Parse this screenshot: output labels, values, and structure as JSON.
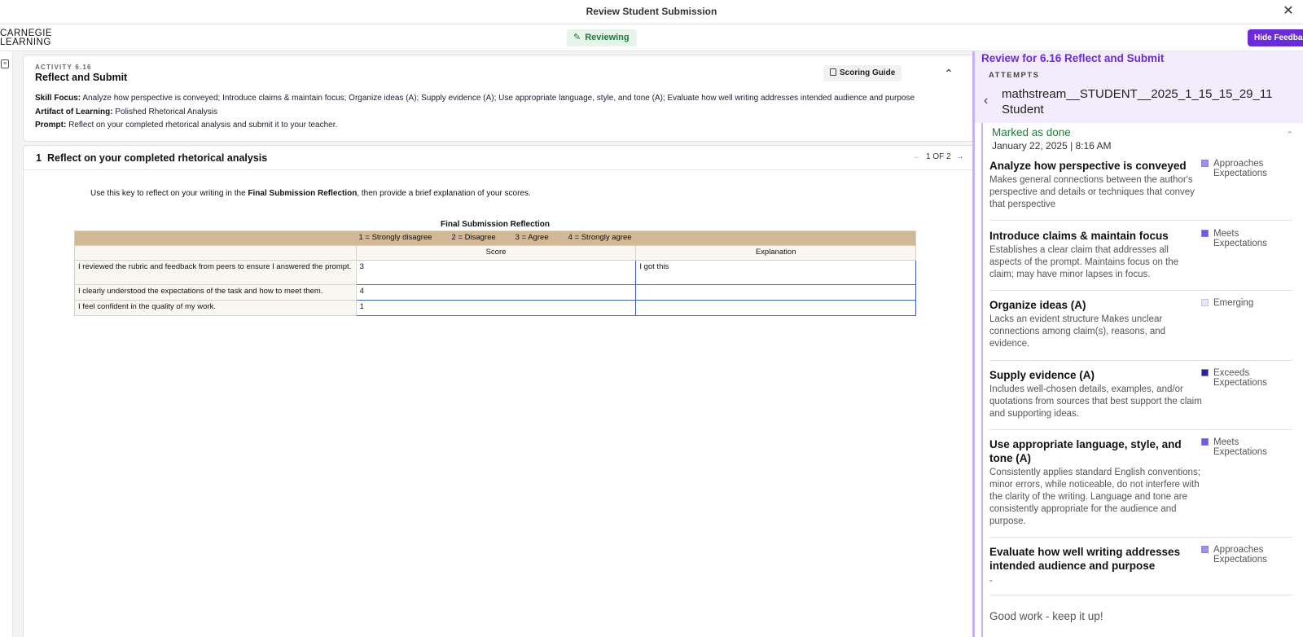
{
  "window": {
    "title": "Review Student Submission",
    "close": "✕"
  },
  "toolbar": {
    "logo_line1": "CARNEGIE",
    "logo_line2": "LEARNING",
    "status_label": "Reviewing",
    "hide_feedback_label": "Hide Feedback"
  },
  "activity": {
    "label": "ACTIVITY 6.16",
    "title": "Reflect and Submit",
    "scoring_guide_label": "Scoring Guide",
    "skill_focus_label": "Skill Focus:",
    "skill_focus": "Analyze how perspective is conveyed; Introduce claims & maintain focus; Organize ideas (A); Supply evidence (A); Use appropriate language, style, and tone (A); Evaluate how well writing addresses intended audience and purpose",
    "artifact_label": "Artifact of Learning:",
    "artifact": "Polished Rhetorical Analysis",
    "prompt_label": "Prompt:",
    "prompt": "Reflect on your completed rhetorical analysis and submit it to your teacher."
  },
  "question": {
    "number": "1",
    "title": "Reflect on your completed rhetorical analysis",
    "pager": "1 OF 2",
    "instruction_pre": "Use this key to reflect on your writing in the ",
    "instruction_bold": "Final Submission Reflection",
    "instruction_post": ", then provide a brief explanation of your scores."
  },
  "reflection_table": {
    "title": "Final Submission Reflection",
    "key": [
      "1 = Strongly disagree",
      "2 = Disagree",
      "3 = Agree",
      "4 = Strongly agree"
    ],
    "headers": [
      "Score",
      "Explanation"
    ],
    "rows": [
      {
        "statement": "I reviewed the rubric and feedback from peers to ensure I answered the prompt.",
        "score": "3",
        "explanation": "I got this"
      },
      {
        "statement": "I clearly understood the expectations of the task and how to meet them.",
        "score": "4",
        "explanation": ""
      },
      {
        "statement": "I feel confident in the quality of my work.",
        "score": "1",
        "explanation": ""
      }
    ]
  },
  "review_panel": {
    "title": "Review for 6.16 Reflect and Submit",
    "attempts_label": "ATTEMPTS",
    "student": "mathstream__STUDENT__2025_1_15_15_29_11 Student",
    "status": "Marked as done",
    "date": "January 22, 2025 | 8:16 AM",
    "criteria": [
      {
        "name": "Analyze how perspective is conveyed",
        "description": "Makes general connections between the author's perspective and details or techniques that convey that perspective",
        "level": "Approaches Expectations",
        "level_color": "#9a90ee"
      },
      {
        "name": "Introduce claims & maintain focus",
        "description": "Establishes a clear claim that addresses all aspects of the prompt. Maintains focus on the claim; may have minor lapses in focus.",
        "level": "Meets Expectations",
        "level_color": "#6a5ce0"
      },
      {
        "name": "Organize ideas (A)",
        "description": "Lacks an evident structure Makes unclear connections among claim(s), reasons, and evidence.",
        "level": "Emerging",
        "level_color": "#e6e3fa"
      },
      {
        "name": "Supply evidence (A)",
        "description": "Includes well-chosen details, examples, and/or quotations from sources that best support the claim and supporting ideas.",
        "level": "Exceeds Expectations",
        "level_color": "#2b2296"
      },
      {
        "name": "Use appropriate language, style, and tone (A)",
        "description": "Consistently applies standard English conventions; minor errors, while noticeable, do not interfere with the clarity of the writing. Language and tone are consistently appropriate for the audience and purpose.",
        "level": "Meets Expectations",
        "level_color": "#6a5ce0"
      },
      {
        "name": "Evaluate how well writing addresses intended audience and purpose",
        "description": "-",
        "level": "Approaches Expectations",
        "level_color": "#9a90ee"
      }
    ],
    "overall_comment": "Good work - keep it up!"
  }
}
